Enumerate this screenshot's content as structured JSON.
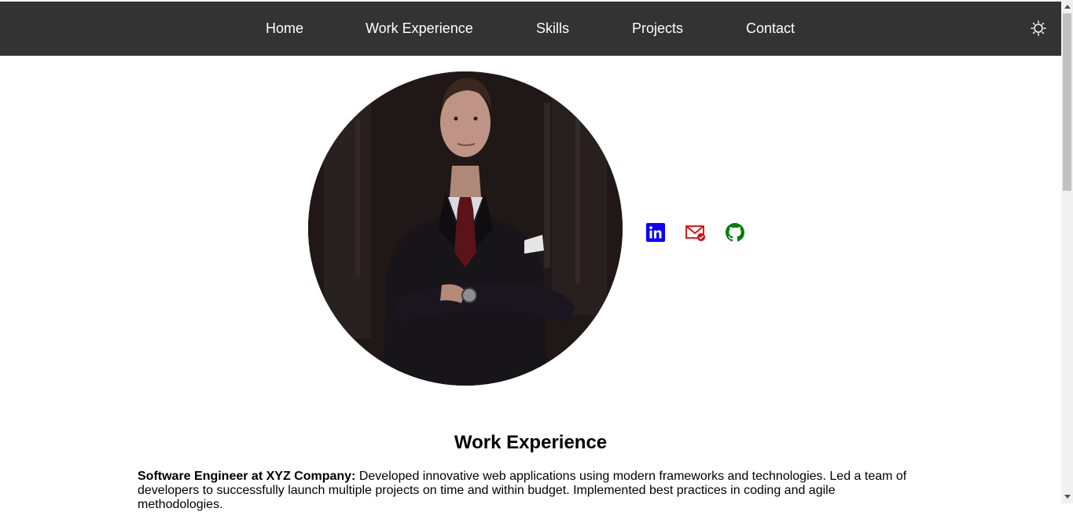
{
  "nav": {
    "items": [
      {
        "label": "Home"
      },
      {
        "label": "Work Experience"
      },
      {
        "label": "Skills"
      },
      {
        "label": "Projects"
      },
      {
        "label": "Contact"
      }
    ],
    "theme_toggle_icon": "sun-icon"
  },
  "hero": {
    "avatar_icon": "profile-photo",
    "social": [
      {
        "icon": "linkedin-icon",
        "color": "#0a00ff"
      },
      {
        "icon": "mail-icon",
        "color": "#e60000"
      },
      {
        "icon": "github-icon",
        "color": "#008000"
      }
    ]
  },
  "work": {
    "title": "Work Experience",
    "jobs": [
      {
        "role": "Software Engineer at XYZ Company:",
        "description": " Developed innovative web applications using modern frameworks and technologies. Led a team of developers to successfully launch multiple projects on time and within budget. Implemented best practices in coding and agile methodologies."
      }
    ]
  },
  "colors": {
    "navbar_bg": "#333333",
    "nav_text": "#ffffff",
    "page_bg": "#ffffff"
  }
}
